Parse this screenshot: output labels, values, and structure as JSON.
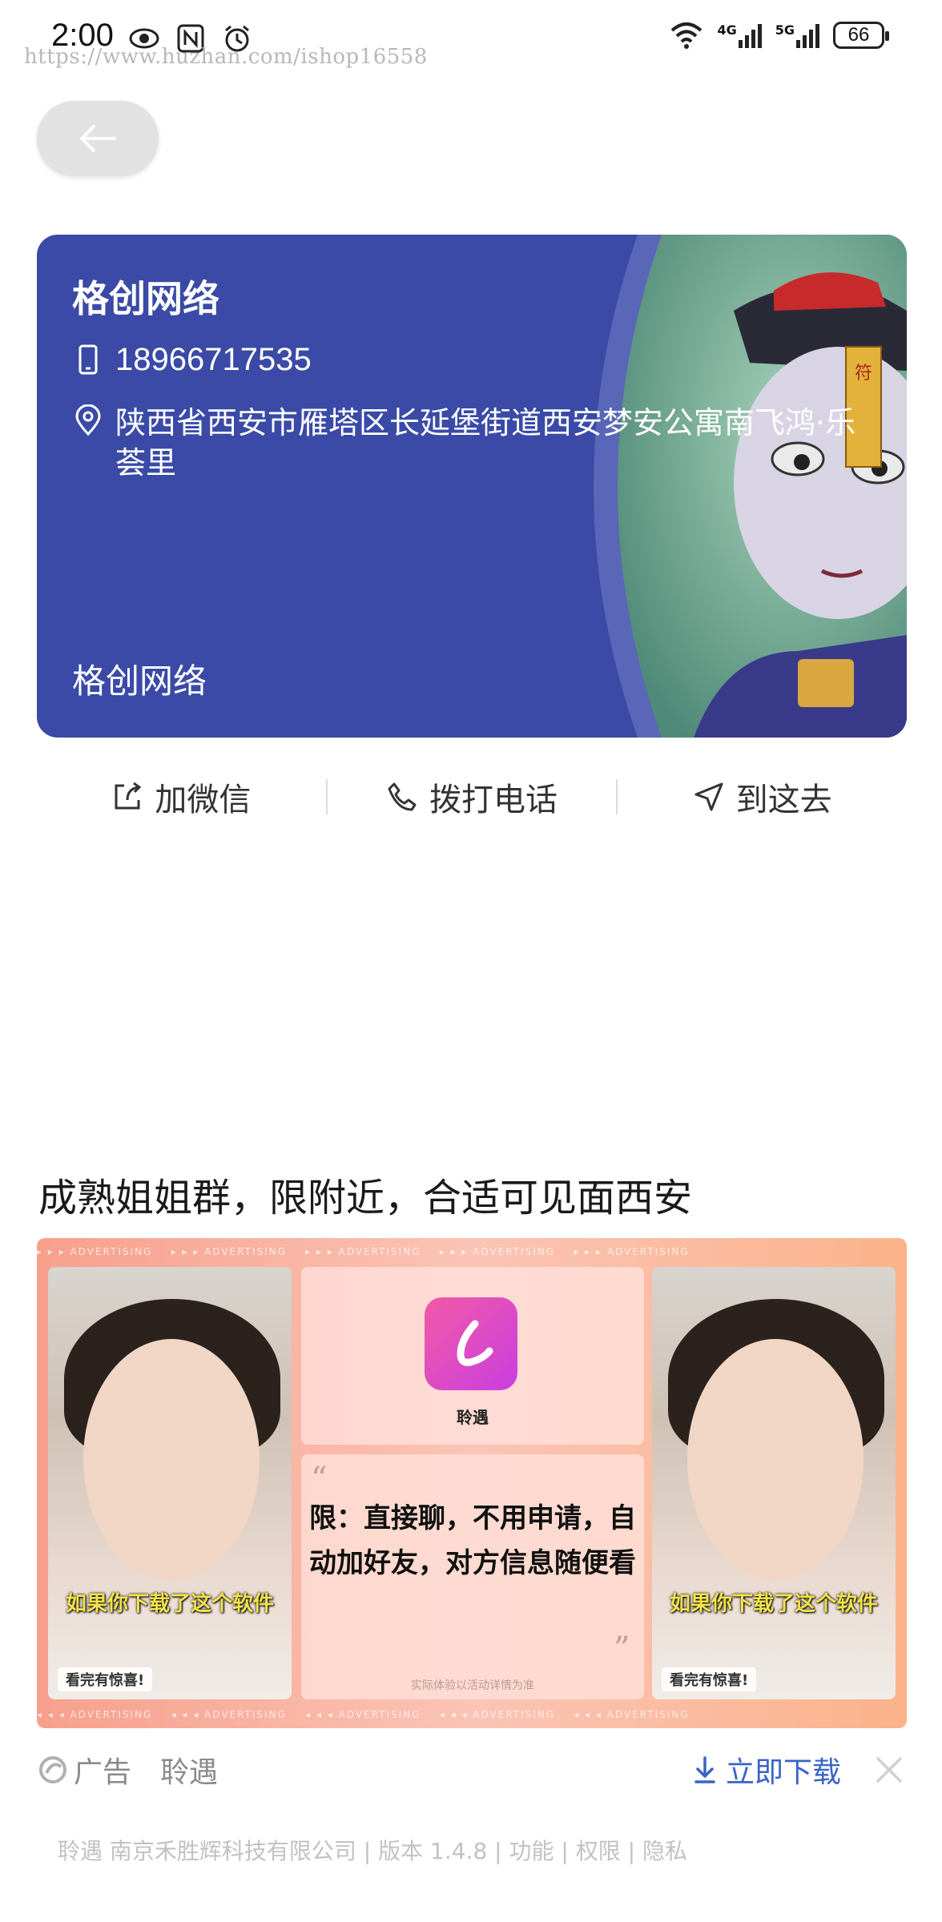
{
  "status_bar": {
    "time": "2:00",
    "watermark": "https://www.huzhan.com/ishop16558",
    "network_1": "4G",
    "network_2": "5G",
    "battery": "66"
  },
  "card": {
    "name": "格创网络",
    "phone": "18966717535",
    "address": "陕西省西安市雁塔区长延堡街道西安梦安公寓南飞鸿·乐荟里",
    "footer": "格创网络",
    "bg_color": "#3a4aa6"
  },
  "actions": {
    "wechat": "加微信",
    "call": "拨打电话",
    "navigate": "到这去"
  },
  "ad": {
    "title": "成熟姐姐群，限附近，合适可见面西安",
    "strip_text": "▸ ▸ ▸ ADVERTISING",
    "app_name": "聆遇",
    "photo_caption": "如果你下载了这个软件",
    "photo_tag": "看完有惊喜!",
    "quote": "限：直接聊，不用申请，自动加好友，对方信息随便看",
    "fine_print": "实际体验以活动详情为准",
    "label": "广告",
    "advertiser": "聆遇",
    "download": "立即下载",
    "meta": "聆遇 南京禾胜辉科技有限公司 | 版本 1.4.8 | 功能 | 权限 | 隐私",
    "accent_color": "#3a63c8"
  }
}
